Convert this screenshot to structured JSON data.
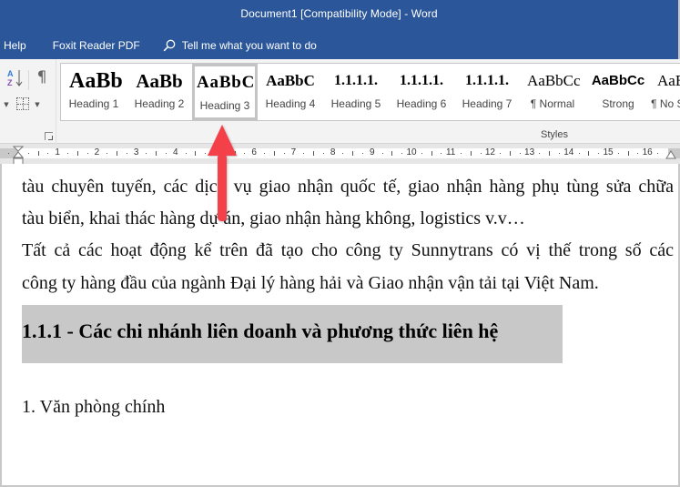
{
  "window": {
    "title": "Document1 [Compatibility Mode]  -  Word"
  },
  "ribbon_tabs": [
    {
      "label": "Help"
    },
    {
      "label": "Foxit Reader PDF"
    }
  ],
  "tell_me": {
    "icon": "search-icon",
    "label": "Tell me what you want to do"
  },
  "paragraph_group": {
    "sort_icon": "sort-az-icon",
    "show_marks_icon": "pilcrow-icon",
    "borders_icon": "borders-icon"
  },
  "styles_gallery": {
    "group_label": "Styles",
    "selected": "Heading 3",
    "items": [
      {
        "preview": "AaBb",
        "label": "Heading 1"
      },
      {
        "preview": "AaBb",
        "label": "Heading 2"
      },
      {
        "preview": "AaBbC",
        "label": "Heading 3"
      },
      {
        "preview": "AaBbC",
        "label": "Heading 4"
      },
      {
        "preview": "1.1.1.1.",
        "label": "Heading 5"
      },
      {
        "preview": "1.1.1.1.",
        "label": "Heading 6"
      },
      {
        "preview": "1.1.1.1.",
        "label": "Heading 7"
      },
      {
        "preview": "AaBbCc",
        "label": "¶ Normal"
      },
      {
        "preview": "AaBbCc",
        "label": "Strong"
      },
      {
        "preview": "AaBbCc",
        "label": "¶ No Spacing"
      }
    ]
  },
  "ruler": {
    "numbers": [
      "1",
      "2",
      "3",
      "4",
      "5",
      "6",
      "7",
      "8",
      "9",
      "10",
      "11",
      "12",
      "13",
      "14",
      "15",
      "16"
    ]
  },
  "document": {
    "lines": [
      "tàu chuyên tuyến, các dịch vụ giao nhận quốc tế, giao nhận hàng phụ tùng sửa chữa",
      "tàu biển, khai thác hàng dự án, giao nhận hàng không, logistics v.v…",
      "Tất cả các hoạt động kể trên đã tạo cho công ty Sunnytrans có vị thế trong số các",
      "công ty hàng đầu của ngành Đại lý hàng hải và Giao nhận vận tải tại Việt Nam."
    ],
    "heading": "1.1.1 - Các chi nhánh liên doanh và phương thức liên hệ",
    "list_item": "1. Văn phòng chính"
  },
  "annotation": {
    "arrow_color": "#f4414a",
    "points_to": "Heading 3"
  },
  "colors": {
    "titlebar": "#2b579a",
    "heading_shading": "#c8c8c8"
  }
}
